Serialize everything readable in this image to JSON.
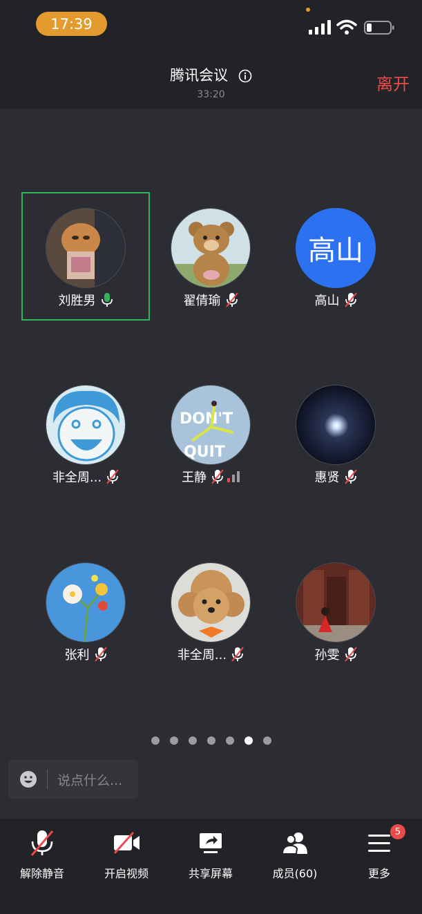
{
  "status_bar": {
    "time": "17:39"
  },
  "header": {
    "title": "腾讯会议",
    "timer": "33:20",
    "leave_label": "离开"
  },
  "participants": [
    {
      "name": "刘胜男",
      "avatar_text": "",
      "speaking": true,
      "muted": false
    },
    {
      "name": "翟倩瑜",
      "avatar_text": "",
      "speaking": false,
      "muted": true
    },
    {
      "name": "高山",
      "avatar_text": "高山",
      "speaking": false,
      "muted": true
    },
    {
      "name": "非全周...",
      "avatar_text": "",
      "speaking": false,
      "muted": true
    },
    {
      "name": "王静",
      "avatar_text": "",
      "speaking": false,
      "muted": true
    },
    {
      "name": "惠贤",
      "avatar_text": "",
      "speaking": false,
      "muted": true
    },
    {
      "name": "张利",
      "avatar_text": "",
      "speaking": false,
      "muted": true
    },
    {
      "name": "非全周...",
      "avatar_text": "",
      "speaking": false,
      "muted": true
    },
    {
      "name": "孙雯",
      "avatar_text": "",
      "speaking": false,
      "muted": true
    }
  ],
  "avatar_text_3": {
    "overlay_word": "DON'T",
    "overlay_word2": "QUIT"
  },
  "pagination": {
    "total": 7,
    "active_index": 5
  },
  "chat": {
    "placeholder": "说点什么..."
  },
  "toolbar": {
    "unmute_label": "解除静音",
    "video_label": "开启视频",
    "share_label": "共享屏幕",
    "members_label": "成员(60)",
    "more_label": "更多",
    "more_badge": "5"
  },
  "colors": {
    "accent_green": "#33b55e",
    "leave_red": "#e94b4b",
    "time_pill": "#e39a2f",
    "avatar_blue": "#2c72f0"
  }
}
